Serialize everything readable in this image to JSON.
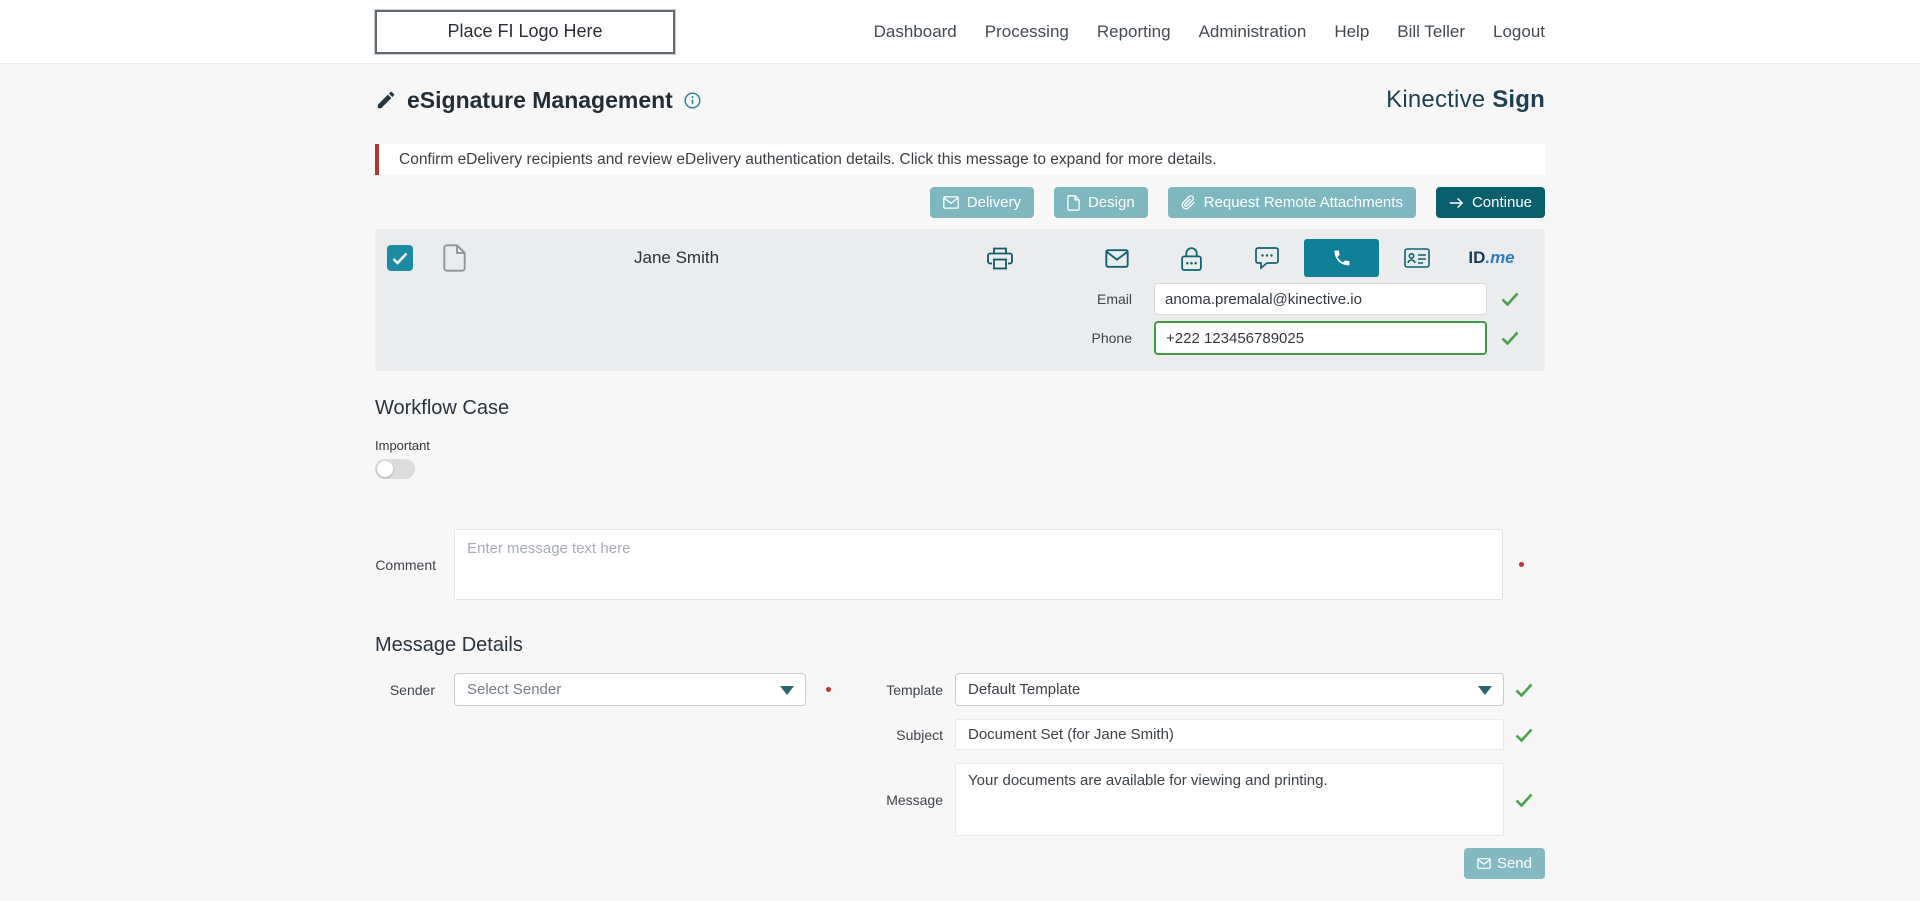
{
  "topbar": {
    "logo_placeholder": "Place FI Logo Here",
    "nav": [
      {
        "label": "Dashboard"
      },
      {
        "label": "Processing"
      },
      {
        "label": "Reporting"
      },
      {
        "label": "Administration"
      },
      {
        "label": "Help"
      },
      {
        "label": "Bill Teller"
      },
      {
        "label": "Logout"
      }
    ]
  },
  "header": {
    "title": "eSignature Management",
    "brand_name": "Kinective",
    "brand_product": "Sign"
  },
  "alert": {
    "text": "Confirm eDelivery recipients and review eDelivery authentication details. Click this message to expand for more details."
  },
  "toolbar": {
    "delivery_label": "Delivery",
    "design_label": "Design",
    "attachments_label": "Request Remote Attachments",
    "continue_label": "Continue"
  },
  "recipient": {
    "name": "Jane Smith",
    "idme_id": "ID",
    "idme_me": ".me",
    "email": {
      "label": "Email",
      "value": "anoma.premalal@kinective.io"
    },
    "phone": {
      "label": "Phone",
      "value": "+222 123456789025"
    }
  },
  "workflow": {
    "heading": "Workflow Case",
    "important_label": "Important",
    "comment_label": "Comment",
    "comment_placeholder": "Enter message text here"
  },
  "message_details": {
    "heading": "Message Details",
    "sender_label": "Sender",
    "sender_value": "Select Sender",
    "template_label": "Template",
    "template_value": "Default Template",
    "subject_label": "Subject",
    "subject_value": "Document Set (for Jane Smith)",
    "message_label": "Message",
    "message_value": "Your documents are available for viewing and printing.",
    "send_label": "Send"
  },
  "icons": {
    "signature-pen-icon": "✎",
    "info-icon": "ⓘ",
    "mail-icon": "✉",
    "design-doc-icon": "🗎",
    "paperclip-icon": "📎",
    "arrow-right-icon": "→",
    "checkbox-check-icon": "✓",
    "document-icon": "🗎",
    "printer-icon": "🖨",
    "password-lock-icon": "🔒",
    "sms-icon": "💬",
    "phone-icon": "📞",
    "id-card-icon": "🪪",
    "valid-check-icon": "✓",
    "dropdown-caret-icon": "▼",
    "required-dot-icon": "•"
  },
  "colors": {
    "dark_teal": "#0a5f6d",
    "light_teal": "#7fb7c1",
    "selected_teal": "#0e7f96",
    "checkbox_teal": "#1d8ca3",
    "success_green": "#46a24a",
    "alert_red": "#b8322d",
    "required_red": "#c9302c",
    "brand_navy": "#1d4152",
    "page_bg": "#f7f7f8",
    "panel_bg": "#ebecee"
  }
}
